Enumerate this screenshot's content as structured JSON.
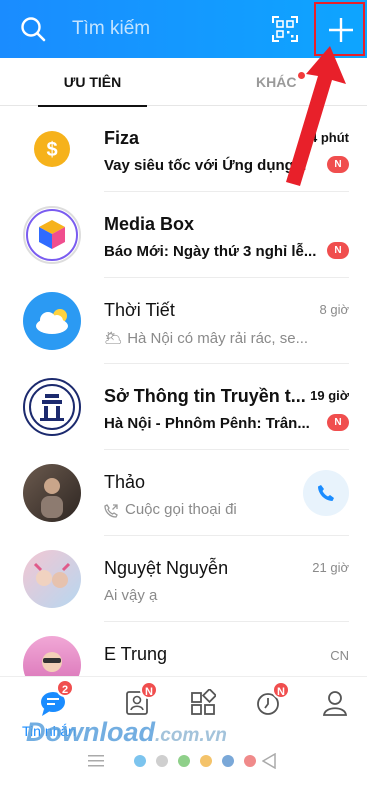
{
  "header": {
    "search_placeholder": "Tìm kiếm",
    "icons": [
      "search-icon",
      "qr-scan-icon",
      "plus-icon"
    ]
  },
  "tabs": {
    "priority": "ƯU TIÊN",
    "other": "KHÁC"
  },
  "conversations": [
    {
      "name": "Fiza",
      "message": "Vay siêu tốc với Ứng dụng...",
      "time": "54 phút",
      "badge": "N",
      "unread": true
    },
    {
      "name": "Media Box",
      "message": "Báo Mới: Ngày thứ 3 nghỉ lễ...",
      "time": "",
      "badge": "N",
      "unread": true
    },
    {
      "name": "Thời Tiết",
      "message": "🌥 Hà Nội có mây rải rác, se...",
      "time": "8 giờ",
      "badge": "",
      "unread": false
    },
    {
      "name": "Sở Thông tin Truyền t...",
      "message": "Hà Nội - Phnôm Pênh: Trân...",
      "time": "19 giờ",
      "badge": "N",
      "unread": true
    },
    {
      "name": "Thảo",
      "message": "Cuộc gọi thoại đi",
      "time": "",
      "badge": "",
      "unread": false
    },
    {
      "name": "Nguyệt Nguyễn",
      "message": "Ai vậy ạ",
      "time": "21 giờ",
      "badge": "",
      "unread": false
    },
    {
      "name": "E Trung",
      "message": "",
      "time": "CN",
      "badge": "",
      "unread": false
    }
  ],
  "bottom_nav": {
    "messages_label": "Tin nhắn",
    "messages_badge": "2",
    "contacts_badge": "N",
    "timeline_badge": "N"
  },
  "watermark": {
    "main": "Download",
    "domain": ".com.vn"
  },
  "colors": {
    "brand": "#1a8cff",
    "badge": "#f04e4e",
    "arrow": "#e8202a"
  }
}
